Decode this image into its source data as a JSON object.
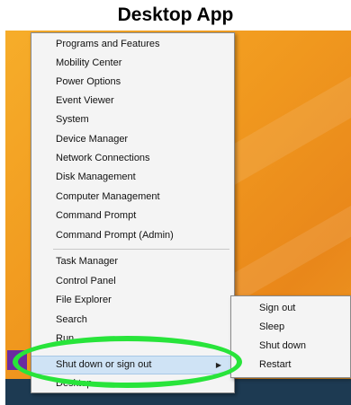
{
  "header": {
    "title": "Desktop App"
  },
  "menu": {
    "items": [
      "Programs and Features",
      "Mobility Center",
      "Power Options",
      "Event Viewer",
      "System",
      "Device Manager",
      "Network Connections",
      "Disk Management",
      "Computer Management",
      "Command Prompt",
      "Command Prompt (Admin)",
      "Task Manager",
      "Control Panel",
      "File Explorer",
      "Search",
      "Run",
      "Shut down or sign out",
      "Desktop"
    ],
    "highlighted": "Shut down or sign out",
    "submenu_arrow": "▶"
  },
  "submenu": {
    "items": [
      "Sign out",
      "Sleep",
      "Shut down",
      "Restart"
    ]
  },
  "colors": {
    "highlight_ring": "#28e43a",
    "desktop": "#f19a1f",
    "menu_highlight": "#cfe3f5"
  }
}
